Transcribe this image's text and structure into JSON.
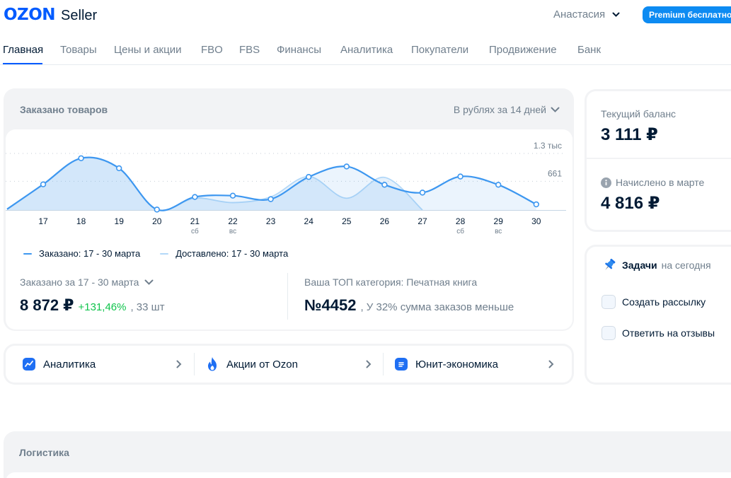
{
  "header": {
    "logo_brand": "OZON",
    "logo_product": "Seller",
    "user_name": "Анастасия",
    "premium_label": "Premium бесплатно"
  },
  "nav": {
    "items": [
      {
        "label": "Главная",
        "active": true
      },
      {
        "label": "Товары"
      },
      {
        "label": "Цены и акции"
      },
      {
        "label": "FBO"
      },
      {
        "label": "FBS"
      },
      {
        "label": "Финансы"
      },
      {
        "label": "Аналитика"
      },
      {
        "label": "Покупатели"
      },
      {
        "label": "Продвижение"
      },
      {
        "label": "Банк"
      }
    ]
  },
  "orders": {
    "title": "Заказано товаров",
    "period_select": "В рублях за 14 дней",
    "summary": {
      "label": "Заказано за 17 - 30 марта",
      "amount": "8 872 ₽",
      "growth": "+131,46%",
      "quantity": ", 33 шт"
    },
    "top_category": {
      "label": "Ваша ТОП категория: Печатная книга",
      "rank": "№4452",
      "note": ", У 32% сумма заказов меньше"
    }
  },
  "chart_data": {
    "type": "line",
    "x": [
      "17",
      "18",
      "19",
      "20",
      "21",
      "22",
      "23",
      "24",
      "25",
      "26",
      "27",
      "28",
      "29",
      "30"
    ],
    "x_sublabels": [
      "",
      "",
      "",
      "",
      "сб",
      "вс",
      "",
      "",
      "",
      "",
      "",
      "сб",
      "вс",
      ""
    ],
    "ticks": [
      {
        "value": 1300,
        "label": "1.3 тыс"
      },
      {
        "value": 661,
        "label": "661"
      }
    ],
    "ylim": [
      0,
      1560
    ],
    "series": [
      {
        "name": "Заказано: 17 - 30 марта",
        "color": "#3d97f0",
        "values": [
          590,
          1190,
          960,
          10,
          300,
          330,
          250,
          760,
          1000,
          580,
          400,
          770,
          580,
          130
        ],
        "markers": true
      },
      {
        "name": "Доставлено: 17 - 30 марта",
        "color": "#b3d8f8",
        "values": [
          590,
          1190,
          960,
          10,
          270,
          170,
          300,
          770,
          270,
          750,
          0,
          null,
          null,
          null
        ],
        "markers": false
      }
    ],
    "grid": true,
    "legend_position": "bottom"
  },
  "quick_links": [
    {
      "label": "Аналитика",
      "icon": "chart-icon"
    },
    {
      "label": "Акции от Ozon",
      "icon": "fire-icon"
    },
    {
      "label": "Юнит-экономика",
      "icon": "document-icon"
    }
  ],
  "balance": {
    "current_label": "Текущий баланс",
    "current_value": "3 111 ₽",
    "accrued_label": "Начислено в марте",
    "accrued_value": "4 816 ₽"
  },
  "tasks": {
    "title": "Задачи",
    "subtitle": "на сегодня",
    "items": [
      {
        "label": "Создать рассылку",
        "checked": false
      },
      {
        "label": "Ответить на отзывы",
        "checked": false
      }
    ]
  },
  "logistics": {
    "title": "Логистика"
  },
  "colors": {
    "brand": "#005bff",
    "accent": "#0d8bf2",
    "positive": "#10c44c"
  }
}
